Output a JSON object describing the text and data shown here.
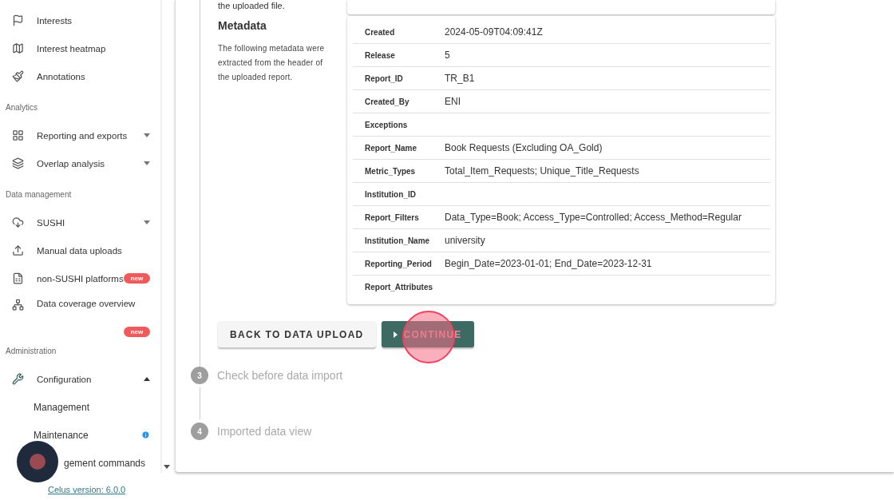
{
  "sidebar": {
    "groups": [
      {
        "items": [
          {
            "label": "Interests",
            "kind": "link"
          },
          {
            "label": "Interest heatmap",
            "kind": "link"
          },
          {
            "label": "Annotations",
            "kind": "link"
          }
        ]
      },
      {
        "title": "Analytics",
        "items": [
          {
            "label": "Reporting and exports",
            "kind": "expandable",
            "expanded": false
          },
          {
            "label": "Overlap analysis",
            "kind": "expandable",
            "expanded": false
          }
        ]
      },
      {
        "title": "Data management",
        "items": [
          {
            "label": "SUSHI",
            "kind": "expandable",
            "expanded": false
          },
          {
            "label": "Manual data uploads",
            "kind": "link"
          },
          {
            "label": "non-SUSHI platforms",
            "kind": "link",
            "badge": "new"
          },
          {
            "label": "Data coverage overview",
            "kind": "link",
            "badge": "new"
          }
        ]
      },
      {
        "title": "Administration",
        "items": [
          {
            "label": "Configuration",
            "kind": "expandable",
            "expanded": true,
            "children": [
              {
                "label": "Management",
                "info": false
              },
              {
                "label": "Maintenance",
                "info": true
              },
              {
                "label": "gement commands",
                "info": false
              }
            ]
          }
        ]
      }
    ],
    "version_link": "Celus version: 6.0.0"
  },
  "intro_tail": "the uploaded file.",
  "metadata": {
    "title": "Metadata",
    "description": "The following metadata were extracted from the header of the uploaded report.",
    "rows": [
      {
        "key": "Created",
        "value": "2024-05-09T04:09:41Z"
      },
      {
        "key": "Release",
        "value": "5"
      },
      {
        "key": "Report_ID",
        "value": "TR_B1"
      },
      {
        "key": "Created_By",
        "value": "ENI"
      },
      {
        "key": "Exceptions",
        "value": ""
      },
      {
        "key": "Report_Name",
        "value": "Book Requests (Excluding OA_Gold)"
      },
      {
        "key": "Metric_Types",
        "value": "Total_Item_Requests; Unique_Title_Requests"
      },
      {
        "key": "Institution_ID",
        "value": ""
      },
      {
        "key": "Report_Filters",
        "value": "Data_Type=Book; Access_Type=Controlled; Access_Method=Regular"
      },
      {
        "key": "Institution_Name",
        "value": "university"
      },
      {
        "key": "Reporting_Period",
        "value": "Begin_Date=2023-01-01; End_Date=2023-12-31"
      },
      {
        "key": "Report_Attributes",
        "value": ""
      }
    ]
  },
  "buttons": [
    {
      "label": "BACK TO DATA UPLOAD",
      "kind": "secondary"
    },
    {
      "label": "CONTINUE",
      "kind": "primary"
    }
  ],
  "steps": [
    {
      "number": "3",
      "label": "Check before data import",
      "active": false
    },
    {
      "number": "4",
      "label": "Imported data view",
      "active": false
    }
  ]
}
